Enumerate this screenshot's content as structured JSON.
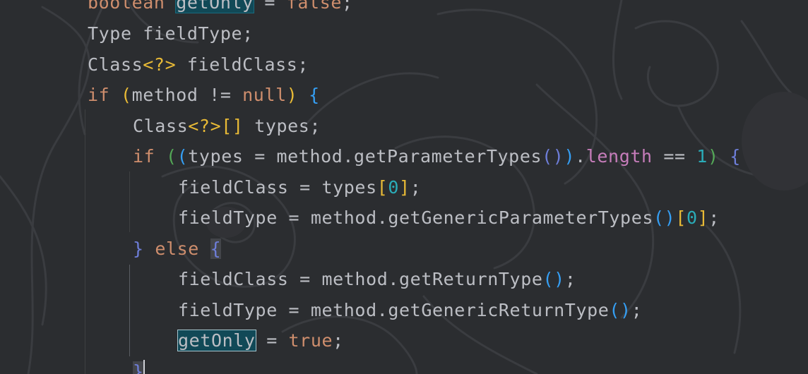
{
  "editor": {
    "language": "Java",
    "theme_colors": {
      "background": "#2b2d30",
      "keyword": "#cf8e6d",
      "identifier": "#bcbec4",
      "field": "#c77dbb",
      "number": "#2aacb8",
      "search_highlight": "#114957"
    },
    "lines": [
      {
        "tokens": [
          {
            "t": "boolean",
            "c": "kw"
          },
          {
            "t": " ",
            "c": "plain"
          },
          {
            "t": "getOnly",
            "c": "plain",
            "hl": "search"
          },
          {
            "t": " = ",
            "c": "op"
          },
          {
            "t": "false",
            "c": "kw"
          },
          {
            "t": ";",
            "c": "op"
          }
        ]
      },
      {
        "tokens": [
          {
            "t": "Type fieldType",
            "c": "plain"
          },
          {
            "t": ";",
            "c": "op"
          }
        ]
      },
      {
        "tokens": [
          {
            "t": "Class",
            "c": "plain"
          },
          {
            "t": "<?>",
            "c": "p1"
          },
          {
            "t": " fieldClass",
            "c": "plain"
          },
          {
            "t": ";",
            "c": "op"
          }
        ]
      },
      {
        "tokens": [
          {
            "t": "if",
            "c": "kw"
          },
          {
            "t": " ",
            "c": "plain"
          },
          {
            "t": "(",
            "c": "p1"
          },
          {
            "t": "method != ",
            "c": "plain"
          },
          {
            "t": "null",
            "c": "kw"
          },
          {
            "t": ")",
            "c": "p1"
          },
          {
            "t": " ",
            "c": "plain"
          },
          {
            "t": "{",
            "c": "p3"
          }
        ]
      },
      {
        "tokens": [
          {
            "t": "Class",
            "c": "plain"
          },
          {
            "t": "<?>",
            "c": "p1"
          },
          {
            "t": "[]",
            "c": "p1"
          },
          {
            "t": " types",
            "c": "plain"
          },
          {
            "t": ";",
            "c": "op"
          }
        ]
      },
      {
        "tokens": [
          {
            "t": "if",
            "c": "kw"
          },
          {
            "t": " ",
            "c": "plain"
          },
          {
            "t": "(",
            "c": "p2"
          },
          {
            "t": "(",
            "c": "p3"
          },
          {
            "t": "types = method.getParameterTypes",
            "c": "plain"
          },
          {
            "t": "()",
            "c": "p4"
          },
          {
            "t": ")",
            "c": "p3"
          },
          {
            "t": ".",
            "c": "plain"
          },
          {
            "t": "length",
            "c": "field"
          },
          {
            "t": " == ",
            "c": "op"
          },
          {
            "t": "1",
            "c": "num"
          },
          {
            "t": ")",
            "c": "p2"
          },
          {
            "t": " ",
            "c": "plain"
          },
          {
            "t": "{",
            "c": "p4"
          }
        ]
      },
      {
        "tokens": [
          {
            "t": "fieldClass = types",
            "c": "plain"
          },
          {
            "t": "[",
            "c": "p1"
          },
          {
            "t": "0",
            "c": "num"
          },
          {
            "t": "]",
            "c": "p1"
          },
          {
            "t": ";",
            "c": "op"
          }
        ]
      },
      {
        "tokens": [
          {
            "t": "fieldType = method.getGenericParameterTypes",
            "c": "plain"
          },
          {
            "t": "()",
            "c": "p3"
          },
          {
            "t": "[",
            "c": "p1"
          },
          {
            "t": "0",
            "c": "num"
          },
          {
            "t": "]",
            "c": "p1"
          },
          {
            "t": ";",
            "c": "op"
          }
        ]
      },
      {
        "tokens": [
          {
            "t": "}",
            "c": "p4"
          },
          {
            "t": " ",
            "c": "plain"
          },
          {
            "t": "else",
            "c": "kw"
          },
          {
            "t": " ",
            "c": "plain"
          },
          {
            "t": "{",
            "c": "p4",
            "hl": "brace"
          }
        ]
      },
      {
        "tokens": [
          {
            "t": "fieldClass = method.getReturnType",
            "c": "plain"
          },
          {
            "t": "()",
            "c": "p3"
          },
          {
            "t": ";",
            "c": "op"
          }
        ]
      },
      {
        "tokens": [
          {
            "t": "fieldType = method.getGenericReturnType",
            "c": "plain"
          },
          {
            "t": "()",
            "c": "p3"
          },
          {
            "t": ";",
            "c": "op"
          }
        ]
      },
      {
        "tokens": [
          {
            "t": "getOnly",
            "c": "plain",
            "hl": "focus"
          },
          {
            "t": " = ",
            "c": "op"
          },
          {
            "t": "true",
            "c": "kw"
          },
          {
            "t": ";",
            "c": "op"
          }
        ]
      },
      {
        "tokens": [
          {
            "t": "}",
            "c": "p4",
            "hl": "brace"
          }
        ]
      }
    ]
  }
}
